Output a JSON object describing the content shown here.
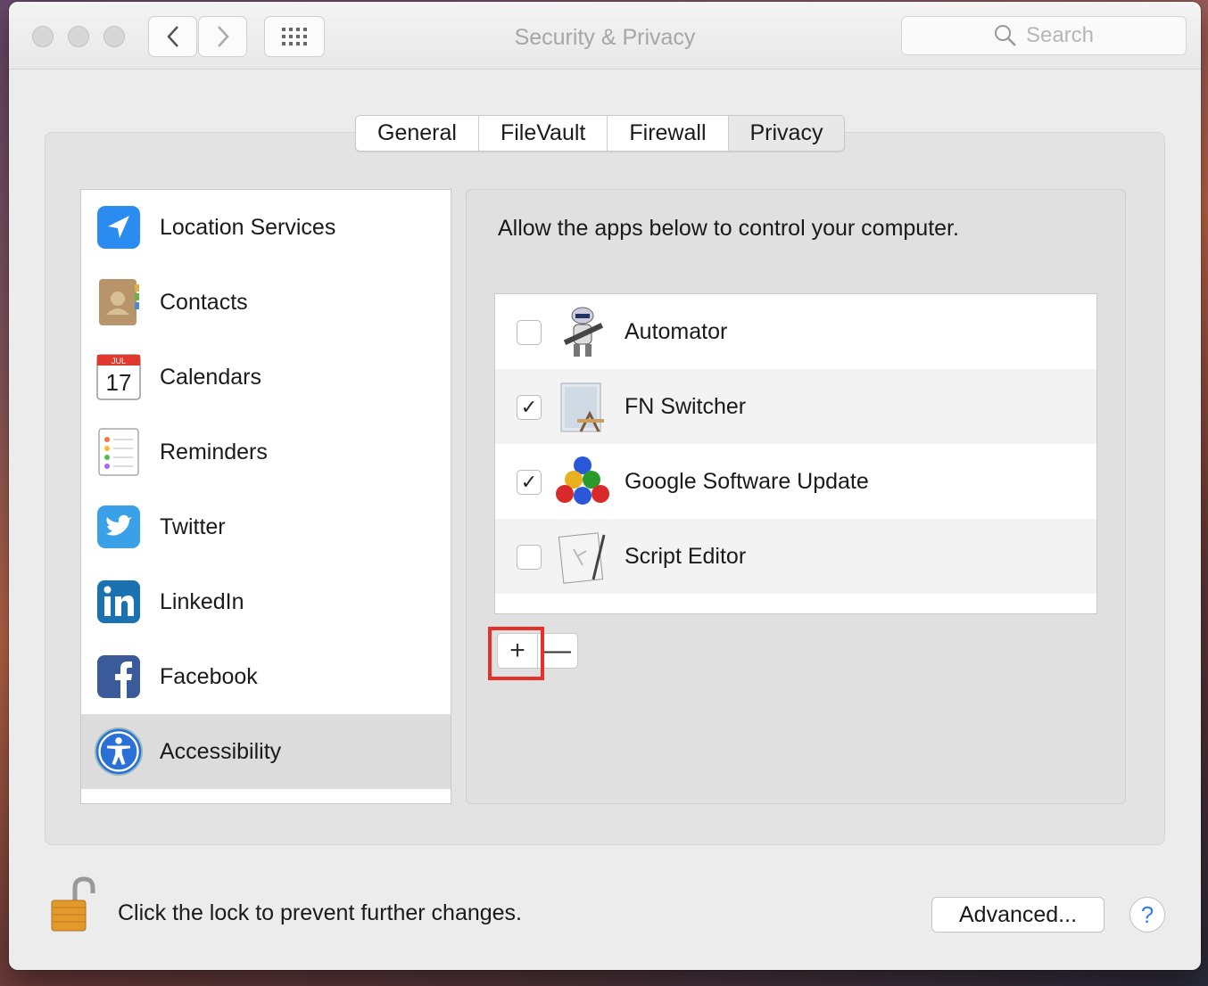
{
  "window": {
    "title": "Security & Privacy"
  },
  "toolbar": {
    "search_placeholder": "Search"
  },
  "tabs": [
    {
      "label": "General"
    },
    {
      "label": "FileVault"
    },
    {
      "label": "Firewall"
    },
    {
      "label": "Privacy",
      "selected": true
    }
  ],
  "sidebar": {
    "items": [
      {
        "label": "Location Services",
        "icon": "location-arrow-icon"
      },
      {
        "label": "Contacts",
        "icon": "contacts-book-icon"
      },
      {
        "label": "Calendars",
        "icon": "calendar-icon",
        "icon_month": "JUL",
        "icon_day": "17"
      },
      {
        "label": "Reminders",
        "icon": "reminders-list-icon"
      },
      {
        "label": "Twitter",
        "icon": "twitter-bird-icon"
      },
      {
        "label": "LinkedIn",
        "icon": "linkedin-icon"
      },
      {
        "label": "Facebook",
        "icon": "facebook-icon"
      },
      {
        "label": "Accessibility",
        "icon": "accessibility-icon",
        "selected": true
      }
    ]
  },
  "main": {
    "description": "Allow the apps below to control your computer.",
    "apps": [
      {
        "name": "Automator",
        "checked": false,
        "icon": "automator-robot-icon"
      },
      {
        "name": "FN Switcher",
        "checked": true,
        "icon": "generic-app-icon"
      },
      {
        "name": "Google Software Update",
        "checked": true,
        "icon": "google-update-balls-icon"
      },
      {
        "name": "Script Editor",
        "checked": false,
        "icon": "script-editor-icon"
      }
    ],
    "add_button": "+",
    "remove_button": "—"
  },
  "footer": {
    "lock_text": "Click the lock to prevent further changes.",
    "advanced_button": "Advanced...",
    "help_button": "?"
  },
  "colors": {
    "accent": "#2f7cf6",
    "highlight": "#e8302a"
  }
}
